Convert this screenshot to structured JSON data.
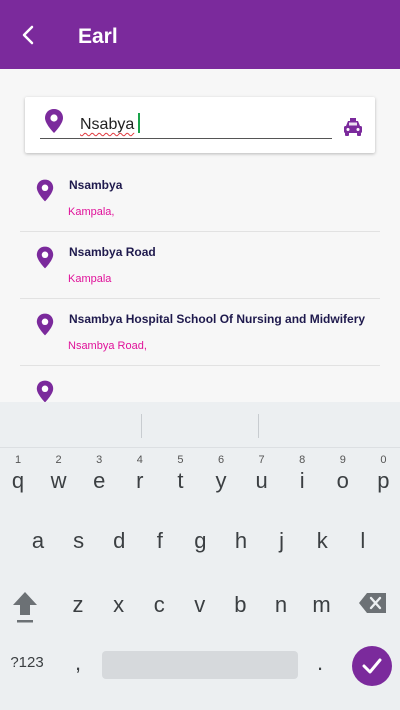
{
  "appbar": {
    "title": "Earl"
  },
  "search": {
    "value": "Nsabya"
  },
  "results": [
    {
      "title": "Nsambya",
      "subtitle": "Kampala,"
    },
    {
      "title": "Nsambya Road",
      "subtitle": "Kampala"
    },
    {
      "title": "Nsambya Hospital School Of Nursing and Midwifery",
      "subtitle": "Nsambya Road,"
    }
  ],
  "keyboard": {
    "row1": [
      {
        "k": "q",
        "h": "1"
      },
      {
        "k": "w",
        "h": "2"
      },
      {
        "k": "e",
        "h": "3"
      },
      {
        "k": "r",
        "h": "4"
      },
      {
        "k": "t",
        "h": "5"
      },
      {
        "k": "y",
        "h": "6"
      },
      {
        "k": "u",
        "h": "7"
      },
      {
        "k": "i",
        "h": "8"
      },
      {
        "k": "o",
        "h": "9"
      },
      {
        "k": "p",
        "h": "0"
      }
    ],
    "row2": [
      "a",
      "s",
      "d",
      "f",
      "g",
      "h",
      "j",
      "k",
      "l"
    ],
    "row3": [
      "z",
      "x",
      "c",
      "v",
      "b",
      "n",
      "m"
    ],
    "symbols": "?123",
    "comma": ",",
    "period": "."
  },
  "colors": {
    "primary": "#7b2a9c",
    "accent": "#e0129a",
    "title_text": "#1f1a4d"
  }
}
